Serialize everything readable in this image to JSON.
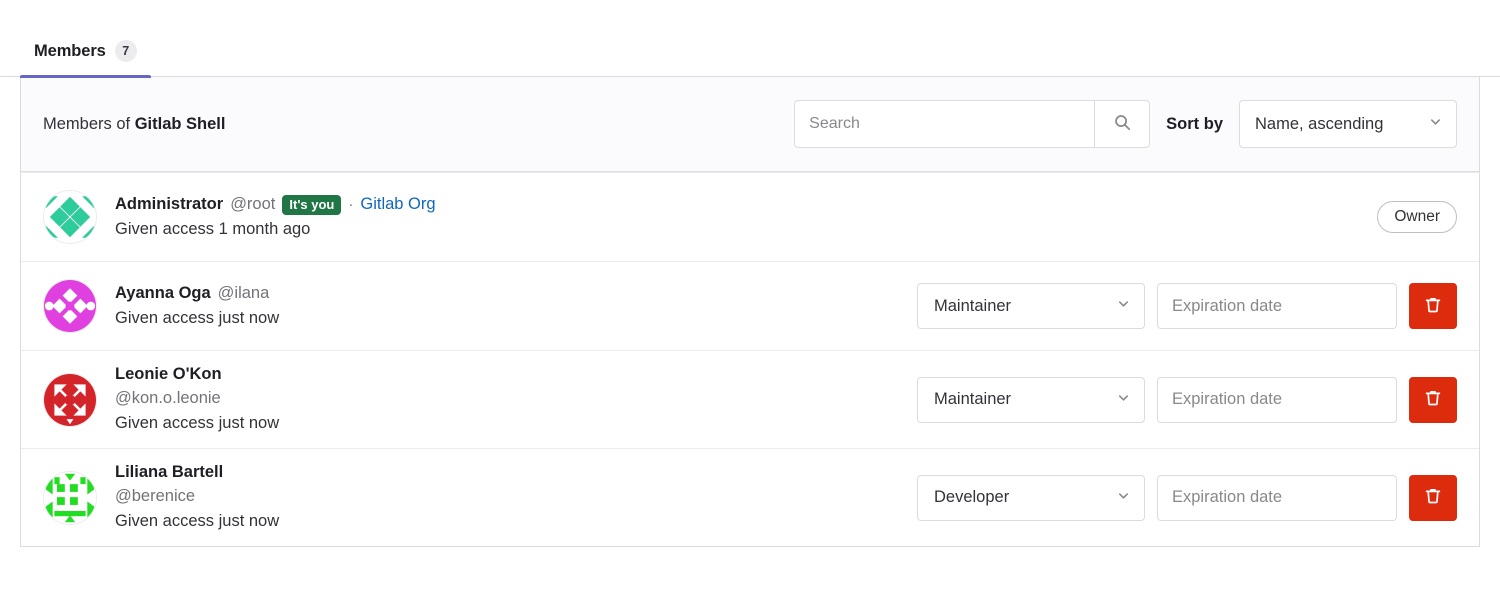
{
  "tabs": [
    {
      "label": "Members",
      "count": "7",
      "active": true
    }
  ],
  "filter_bar": {
    "title_prefix": "Members of ",
    "title_entity": "Gitlab Shell",
    "search_placeholder": "Search",
    "search_value": "",
    "search_icon": "search-icon",
    "sort_label": "Sort by",
    "sort_value": "Name, ascending",
    "sort_caret_icon": "chevron-down-icon"
  },
  "colors": {
    "tab_active_underline": "#6666c4",
    "badge_you_bg": "#217645",
    "link_blue": "#1068bf",
    "delete_red": "#dd2b0e",
    "filter_bar_bg": "#fbfafd",
    "border_gray": "#dcdcde"
  },
  "members": [
    {
      "name": "Administrator",
      "handle": "@root",
      "badge": "It's you",
      "separator": "·",
      "org": "Gitlab Org",
      "access": "Given access 1 month ago",
      "role_badge": "Owner",
      "avatar_color": "#2ecc9a",
      "avatar_style": "diamond",
      "has_controls": false,
      "wrap_handle": false
    },
    {
      "name": "Ayanna Oga",
      "handle": "@ilana",
      "access": "Given access just now",
      "role": "Maintainer",
      "expiration_placeholder": "Expiration date",
      "expiration_value": "",
      "delete_icon": "trash-icon",
      "role_caret_icon": "chevron-down-icon",
      "avatar_color": "#e040e0",
      "avatar_style": "ornate",
      "has_controls": true,
      "wrap_handle": false
    },
    {
      "name": "Leonie O'Kon",
      "handle": "@kon.o.leonie",
      "access": "Given access just now",
      "role": "Maintainer",
      "expiration_placeholder": "Expiration date",
      "expiration_value": "",
      "delete_icon": "trash-icon",
      "role_caret_icon": "chevron-down-icon",
      "avatar_color": "#d3242a",
      "avatar_style": "checker",
      "has_controls": true,
      "wrap_handle": true
    },
    {
      "name": "Liliana Bartell",
      "handle": "@berenice",
      "access": "Given access just now",
      "role": "Developer",
      "expiration_placeholder": "Expiration date",
      "expiration_value": "",
      "delete_icon": "trash-icon",
      "role_caret_icon": "chevron-down-icon",
      "avatar_color": "#22dd22",
      "avatar_style": "grid",
      "has_controls": true,
      "wrap_handle": true
    }
  ]
}
